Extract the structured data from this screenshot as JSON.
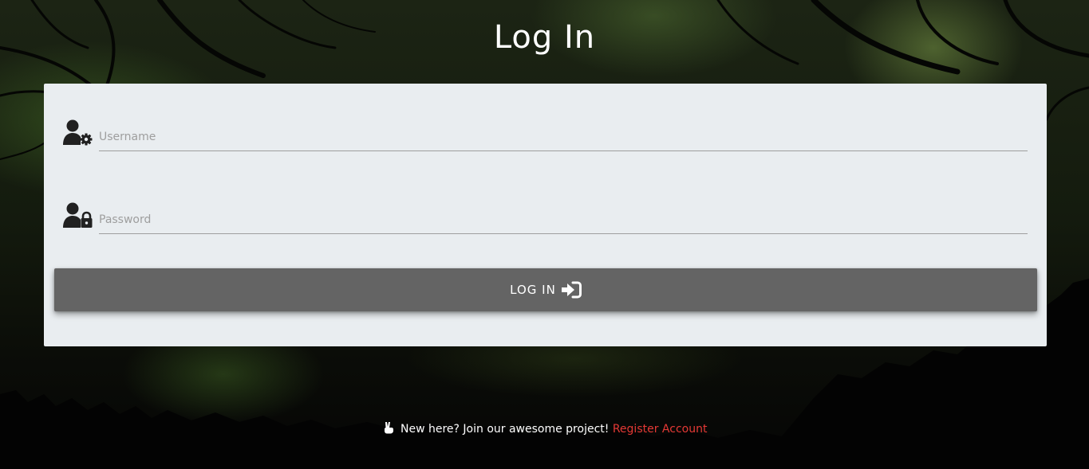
{
  "page": {
    "title": "Log In"
  },
  "form": {
    "username": {
      "placeholder": "Username",
      "value": "",
      "icon": "user-gear-icon"
    },
    "password": {
      "placeholder": "Password",
      "value": "",
      "icon": "user-lock-icon"
    },
    "submit": {
      "label": "LOG IN",
      "icon": "sign-in-icon"
    }
  },
  "footer": {
    "icon": "peace-hand-icon",
    "text": "New here? Join our awesome project!",
    "link_label": "Register Account"
  },
  "colors": {
    "card_background": "#e9edf0",
    "button_background": "#646464",
    "link": "#e53935",
    "title": "#ffffff"
  }
}
